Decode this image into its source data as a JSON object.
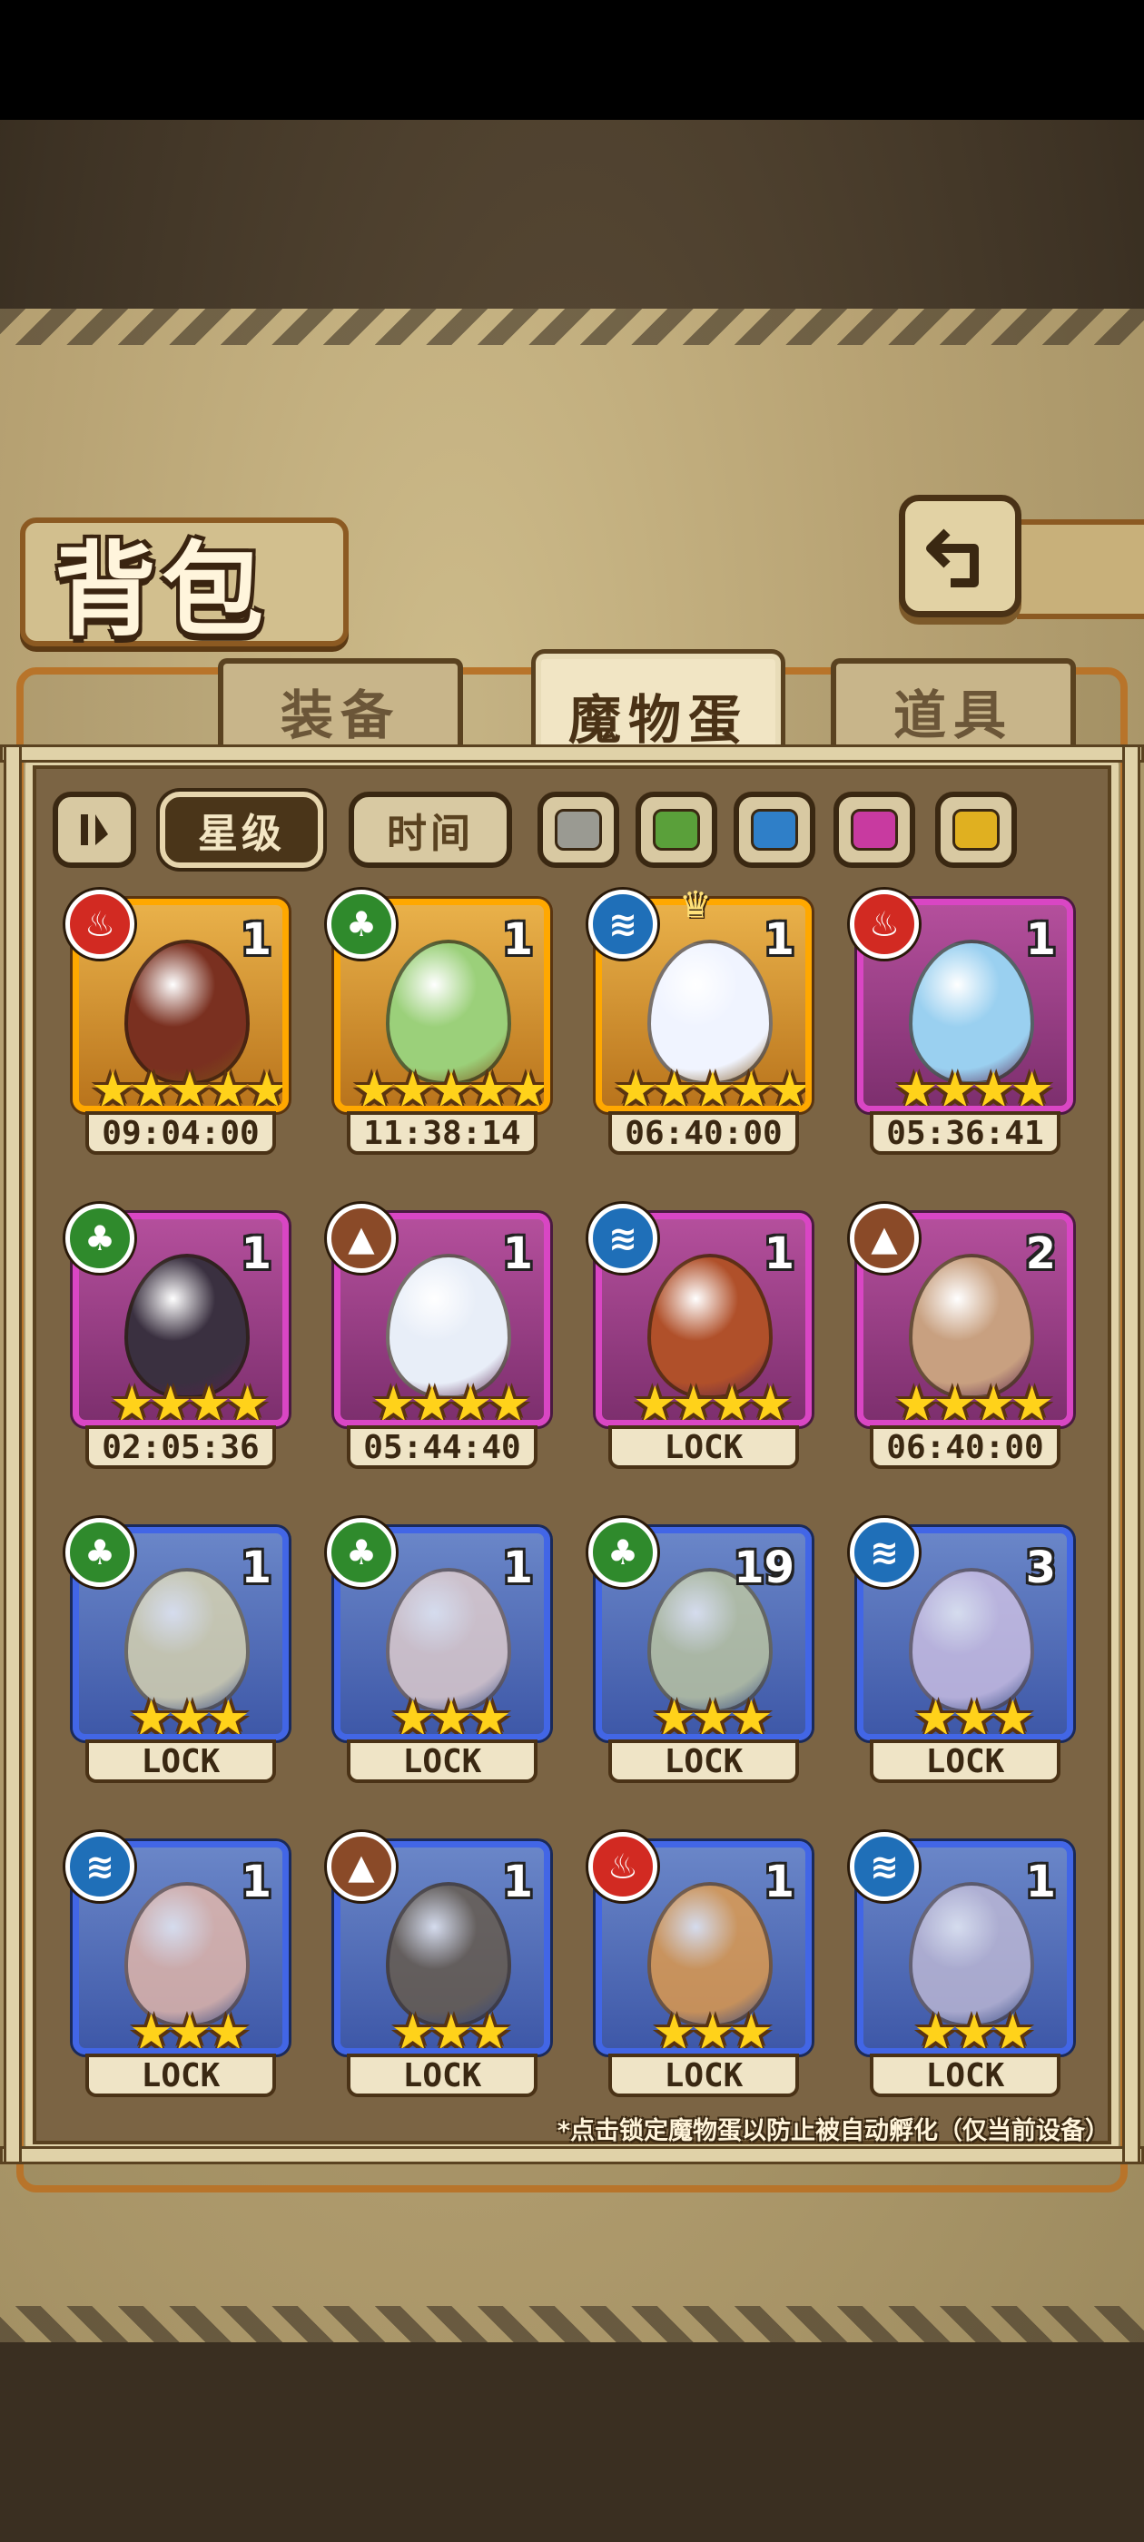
{
  "title": "背包",
  "tabs": [
    {
      "label": "装备",
      "active": false
    },
    {
      "label": "魔物蛋",
      "active": true
    },
    {
      "label": "道具",
      "active": false
    }
  ],
  "filters": {
    "sort_icon": "pause-sort-icon",
    "star_label": "星级",
    "time_label": "时间",
    "color_swatches": [
      "#9a9a92",
      "#5aa03a",
      "#2f7fc8",
      "#c83aa0",
      "#e0b020"
    ]
  },
  "eggs": [
    {
      "element": "fire",
      "count": "1",
      "stars": "★★★★★",
      "rarity": "gold",
      "timer": "09:04:00",
      "color": "#7a3020"
    },
    {
      "element": "grass",
      "count": "1",
      "stars": "★★★★★",
      "rarity": "gold",
      "timer": "11:38:14",
      "color": "#9bd07a"
    },
    {
      "element": "water",
      "count": "1",
      "stars": "★★★★★",
      "rarity": "gold",
      "timer": "06:40:00",
      "color": "#f0f4ff"
    },
    {
      "element": "fire",
      "count": "1",
      "stars": "★★★★",
      "rarity": "purple",
      "timer": "05:36:41",
      "color": "#9ad0f0"
    },
    {
      "element": "grass",
      "count": "1",
      "stars": "★★★★",
      "rarity": "purple",
      "timer": "02:05:36",
      "color": "#3a3040"
    },
    {
      "element": "earth",
      "count": "1",
      "stars": "★★★★",
      "rarity": "purple",
      "timer": "05:44:40",
      "color": "#e8eef8"
    },
    {
      "element": "water",
      "count": "1",
      "stars": "★★★★",
      "rarity": "purple",
      "timer": "LOCK",
      "color": "#b0502a"
    },
    {
      "element": "earth",
      "count": "2",
      "stars": "★★★★",
      "rarity": "purple",
      "timer": "06:40:00",
      "color": "#c8a080"
    },
    {
      "element": "grass",
      "count": "1",
      "stars": "★★★",
      "rarity": "blue",
      "timer": "LOCK",
      "color": "#e8e0b0"
    },
    {
      "element": "grass",
      "count": "1",
      "stars": "★★★",
      "rarity": "blue",
      "timer": "LOCK",
      "color": "#f0d8d0"
    },
    {
      "element": "grass",
      "count": "19",
      "stars": "★★★",
      "rarity": "blue",
      "timer": "LOCK",
      "color": "#c8d0a0"
    },
    {
      "element": "water",
      "count": "3",
      "stars": "★★★",
      "rarity": "blue",
      "timer": "LOCK",
      "color": "#d8c8e8"
    },
    {
      "element": "water",
      "count": "1",
      "stars": "★★★",
      "rarity": "blue",
      "timer": "LOCK",
      "color": "#f4c0a8"
    },
    {
      "element": "earth",
      "count": "1",
      "stars": "★★★",
      "rarity": "blue",
      "timer": "LOCK",
      "color": "#6a5a40"
    },
    {
      "element": "fire",
      "count": "1",
      "stars": "★★★",
      "rarity": "blue",
      "timer": "LOCK",
      "color": "#f0a040"
    },
    {
      "element": "water",
      "count": "1",
      "stars": "★★★",
      "rarity": "blue",
      "timer": "LOCK",
      "color": "#c8c0d8"
    }
  ],
  "footnote": "*点击锁定魔物蛋以防止被自动孵化（仅当前设备）"
}
